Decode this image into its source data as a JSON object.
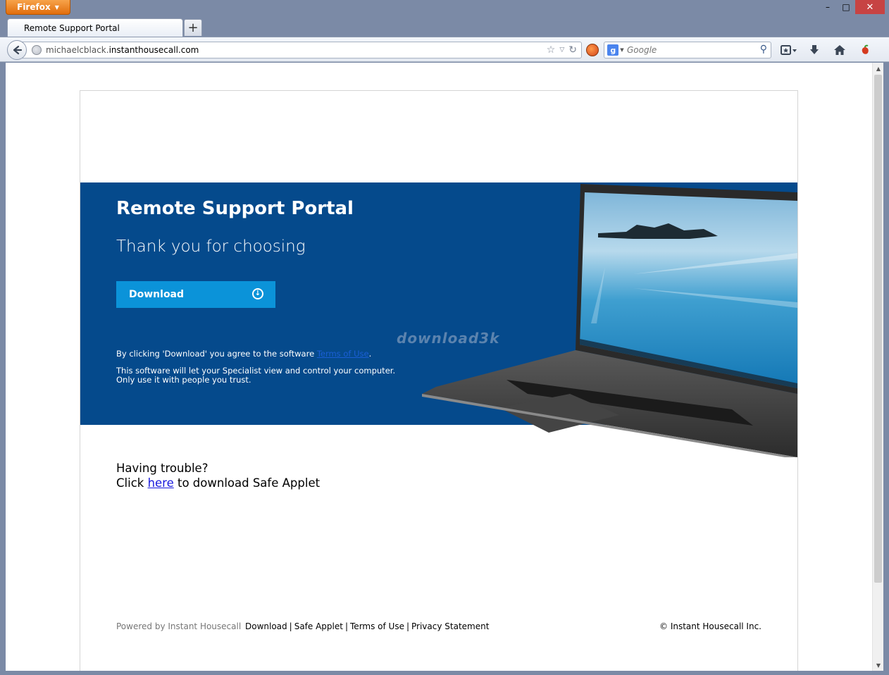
{
  "browser": {
    "app_button": "Firefox",
    "tab_title": "Remote Support Portal",
    "new_tab": "+",
    "url_prefix": "michaelcblack.",
    "url_domain": "instanthousecall.com",
    "search_placeholder": "Google",
    "window_controls": {
      "minimize": "–",
      "maximize": "□",
      "close": "✕"
    }
  },
  "page": {
    "hero": {
      "title": "Remote Support Portal",
      "subtitle": "Thank you for choosing",
      "download_label": "Download",
      "agree_prefix": "By clicking 'Download' you agree to the software ",
      "terms_link": "Terms of Use",
      "agree_suffix": ".",
      "notice_line1": "This software will let your Specialist view and control your computer.",
      "notice_line2": "Only use it with people you trust.",
      "watermark": "download3k",
      "background_color": "#054a8c",
      "button_color": "#0b93d9"
    },
    "trouble": {
      "line1": "Having trouble?",
      "click": "Click ",
      "here_link": "here",
      "rest": " to download Safe Applet"
    },
    "footer": {
      "powered_by": "Powered by Instant Housecall",
      "links": [
        "Download",
        "Safe Applet",
        "Terms of Use",
        "Privacy Statement"
      ],
      "separator": "|",
      "copyright": "© Instant Housecall Inc."
    }
  }
}
